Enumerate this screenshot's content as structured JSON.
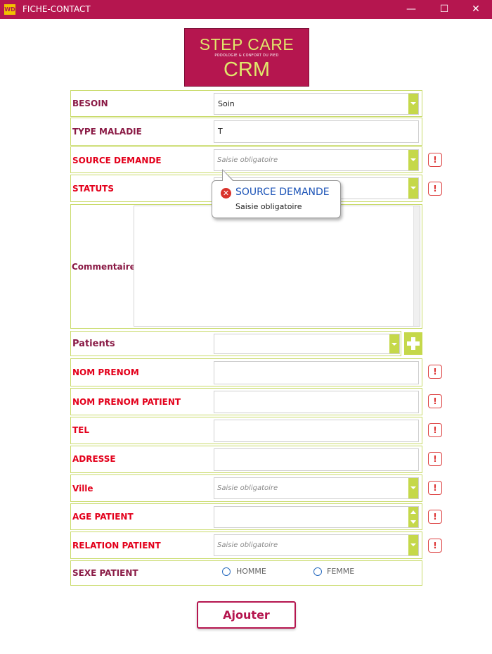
{
  "window": {
    "icon_text": "WD",
    "title": "FICHE-CONTACT",
    "minimize": "—",
    "maximize": "☐",
    "close": "✕"
  },
  "logo": {
    "line1": "STEP CARE",
    "tagline": "PODOLOGIE & CONFORT DU PIED",
    "line2": "CRM"
  },
  "colors": {
    "brand": "#b5164f",
    "accent": "#c5d84a",
    "error": "#e3001b",
    "logo_text": "#e0e86b"
  },
  "form": {
    "besoin": {
      "label": "BESOIN",
      "value": "Soin"
    },
    "type_maladie": {
      "label": "TYPE MALADIE",
      "value": "T"
    },
    "source_demande": {
      "label": "SOURCE DEMANDE",
      "placeholder": "Saisie obligatoire"
    },
    "statuts": {
      "label": "STATUTS",
      "value": ""
    },
    "commentaire": {
      "label": "Commentaire",
      "value": ""
    },
    "patients": {
      "label": "Patients",
      "value": ""
    },
    "nom_prenom": {
      "label": "NOM PRENOM",
      "value": ""
    },
    "nom_prenom_patient": {
      "label": "NOM PRENOM PATIENT",
      "value": ""
    },
    "tel": {
      "label": "TEL",
      "value": ""
    },
    "adresse": {
      "label": "ADRESSE",
      "value": ""
    },
    "ville": {
      "label": "Ville",
      "placeholder": "Saisie obligatoire"
    },
    "age_patient": {
      "label": "AGE PATIENT",
      "value": ""
    },
    "relation_patient": {
      "label": "RELATION PATIENT",
      "placeholder": "Saisie obligatoire"
    },
    "sexe_patient": {
      "label": "SEXE PATIENT",
      "options": [
        "HOMME",
        "FEMME"
      ]
    }
  },
  "warning_icon": "!",
  "tooltip": {
    "title": "SOURCE DEMANDE",
    "message": "Saisie obligatoire",
    "icon": "✕"
  },
  "actions": {
    "submit_label": "Ajouter"
  }
}
